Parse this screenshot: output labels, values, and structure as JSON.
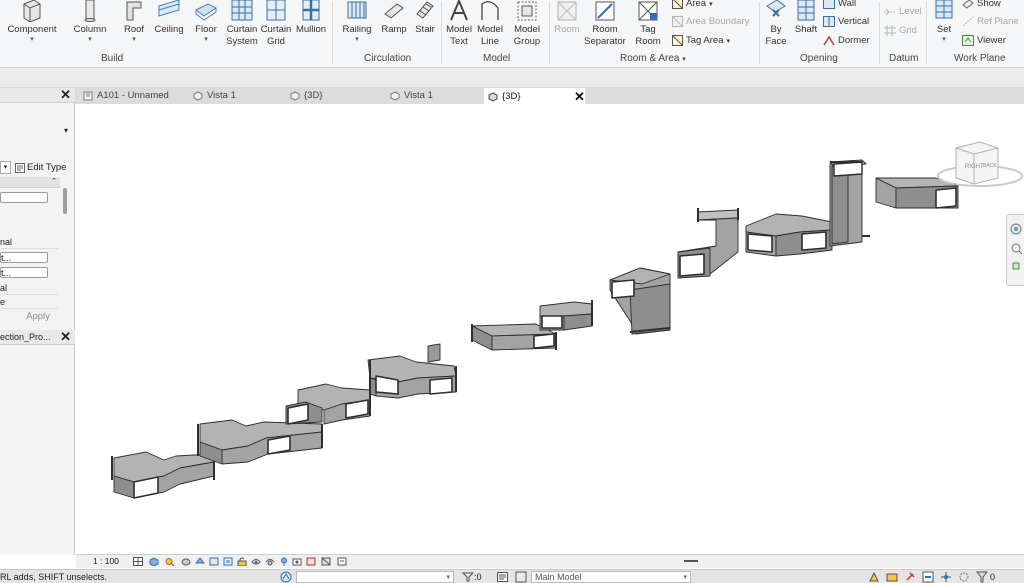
{
  "ribbon": {
    "tools": {
      "component": "Component",
      "column": "Column",
      "roof": "Roof",
      "ceiling": "Ceiling",
      "floor": "Floor",
      "curtain_system_1": "Curtain",
      "curtain_system_2": "System",
      "curtain_grid_1": "Curtain",
      "curtain_grid_2": "Grid",
      "mullion": "Mullion",
      "railing": "Railing",
      "ramp": "Ramp",
      "stair": "Stair",
      "model_text_1": "Model",
      "model_text_2": "Text",
      "model_line_1": "Model",
      "model_line_2": "Line",
      "model_group_1": "Model",
      "model_group_2": "Group",
      "room": "Room",
      "room_separator_1": "Room",
      "room_separator_2": "Separator",
      "tag_room_1": "Tag",
      "tag_room_2": "Room",
      "area": "Area",
      "area_boundary": "Area Boundary",
      "tag_area": "Tag  Area",
      "by_face_1": "By",
      "by_face_2": "Face",
      "shaft": "Shaft",
      "wall": "Wall",
      "vertical": "Vertical",
      "dormer": "Dormer",
      "level": "Level",
      "grid": "Grid",
      "set": "Set",
      "show": "Show",
      "ref_plane": "Ref  Plane",
      "viewer": "Viewer"
    },
    "panels": {
      "build": "Build",
      "circulation": "Circulation",
      "model": "Model",
      "room_area": "Room & Area",
      "opening": "Opening",
      "datum": "Datum",
      "work_plane": "Work Plane"
    }
  },
  "properties": {
    "edit_type": "Edit Type",
    "rows": [
      "nal",
      "t...",
      "t...",
      "al",
      "e"
    ],
    "apply": "Apply"
  },
  "project_browser": {
    "title": "ection_Pro..."
  },
  "tabs": [
    {
      "label": "A101 - Unnamed",
      "active": false
    },
    {
      "label": "Vista 1",
      "active": false
    },
    {
      "label": "{3D}",
      "active": false
    },
    {
      "label": "Vista 1",
      "active": false
    },
    {
      "label": "{3D}",
      "active": true
    }
  ],
  "viewcube": {
    "right": "RIGHT",
    "back": "BACK"
  },
  "view_control": {
    "scale": "1 : 100"
  },
  "status": {
    "hint": "RL adds, SHIFT unselects.",
    "selection_count": ":0",
    "workset": "Main Model"
  },
  "colors": {
    "duct_top": "#b3b3b3",
    "duct_side": "#8e8e8e",
    "duct_front": "#a3a3a3",
    "duct_edge": "#2e2e2e",
    "ribbon_bg": "#f5f6f7",
    "accent_blue": "#2f6fb5"
  }
}
